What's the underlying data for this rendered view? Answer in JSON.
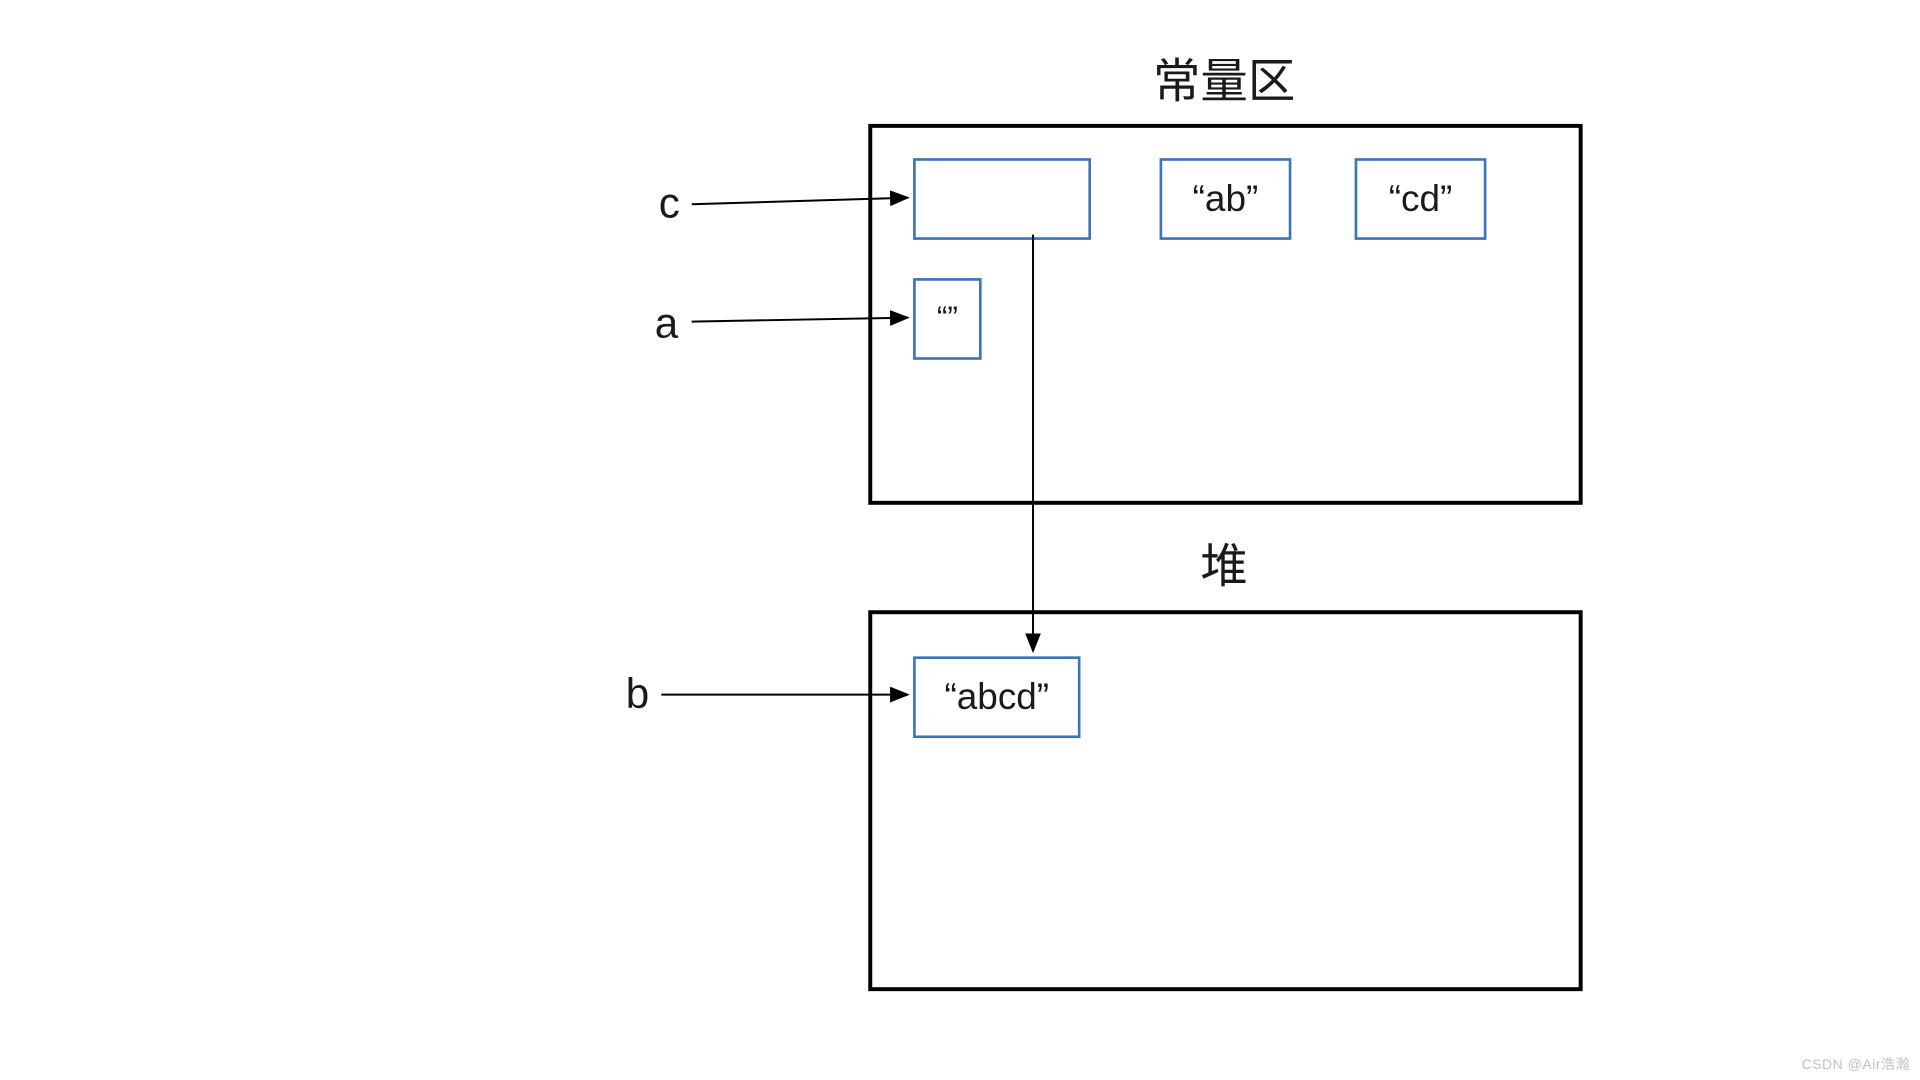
{
  "titles": {
    "constant_area": "常量区",
    "heap": "堆"
  },
  "vars": {
    "c": "c",
    "a": "a",
    "b": "b"
  },
  "boxes": {
    "c_ref": "",
    "ab": "“ab”",
    "cd": "“cd”",
    "empty": "“”",
    "abcd": "“abcd”"
  },
  "watermark": "CSDN @Air浩瀚"
}
